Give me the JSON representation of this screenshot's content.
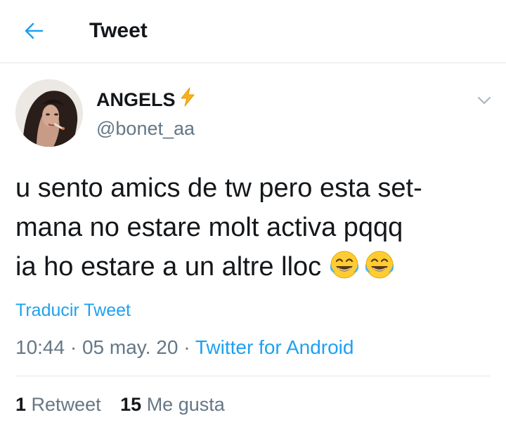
{
  "header": {
    "title": "Tweet",
    "back_icon": "arrow-left-icon"
  },
  "author": {
    "display_name": "ANGELS",
    "name_emoji": "high-voltage-emoji",
    "handle": "@bonet_aa"
  },
  "tweet": {
    "lines": [
      "u sento amics de tw pero esta set-",
      "mana no estare molt activa pqqq",
      "ia ho estare a un altre lloc"
    ],
    "trailing_emoji": [
      "face-with-tears-of-joy-emoji",
      "face-with-tears-of-joy-emoji"
    ],
    "translate_label": "Traducir Tweet",
    "time": "10:44",
    "date": "05 may. 20",
    "separator": "·",
    "source": "Twitter for Android"
  },
  "stats": {
    "retweets_count": "1",
    "retweets_label": "Retweet",
    "likes_count": "15",
    "likes_label": "Me gusta"
  },
  "colors": {
    "accent": "#1da1f2",
    "text": "#14171a",
    "secondary": "#657786",
    "divider": "#e1e8ed"
  }
}
